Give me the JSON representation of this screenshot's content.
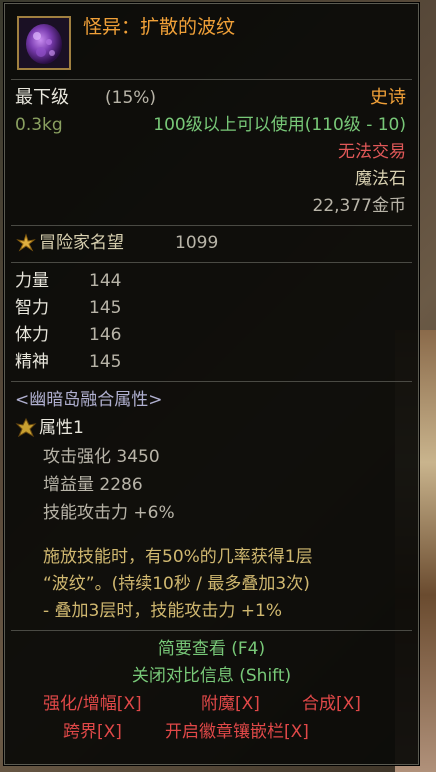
{
  "item": {
    "name": "怪异：扩散的波纹",
    "grade": "最下级",
    "grade_pct": "(15%)",
    "rarity": "史诗",
    "weight": "0.3kg",
    "level_req": "100级以上可以使用(110级 - 10)",
    "trade": "无法交易",
    "type": "魔法石",
    "price": "22,377金币"
  },
  "fame": {
    "label": "冒险家名望",
    "value": "1099"
  },
  "stats": [
    {
      "label": "力量",
      "value": "144"
    },
    {
      "label": "智力",
      "value": "145"
    },
    {
      "label": "体力",
      "value": "146"
    },
    {
      "label": "精神",
      "value": "145"
    }
  ],
  "fusion": {
    "header": "<幽暗岛融合属性>",
    "attr_title": "属性1",
    "lines": [
      "攻击强化 3450",
      "增益量 2286",
      "技能攻击力 +6%"
    ],
    "desc": [
      "施放技能时，有50%的几率获得1层",
      "“波纹”。(持续10秒 / 最多叠加3次)",
      "- 叠加3层时，技能攻击力 +1%"
    ]
  },
  "actions": {
    "quick_view": "简要查看 (F4)",
    "close_compare": "关闭对比信息 (Shift)",
    "enhance": "强化/增幅[X]",
    "enchant": "附魔[X]",
    "synth": "合成[X]",
    "cross": "跨界[X]",
    "emblem": "开启徽章镶嵌栏[X]"
  },
  "colors": {
    "name": "#f0a038",
    "rarity": "#f0a038",
    "trade": "#e05858",
    "green": "#78c878",
    "red_link": "#e04848"
  }
}
